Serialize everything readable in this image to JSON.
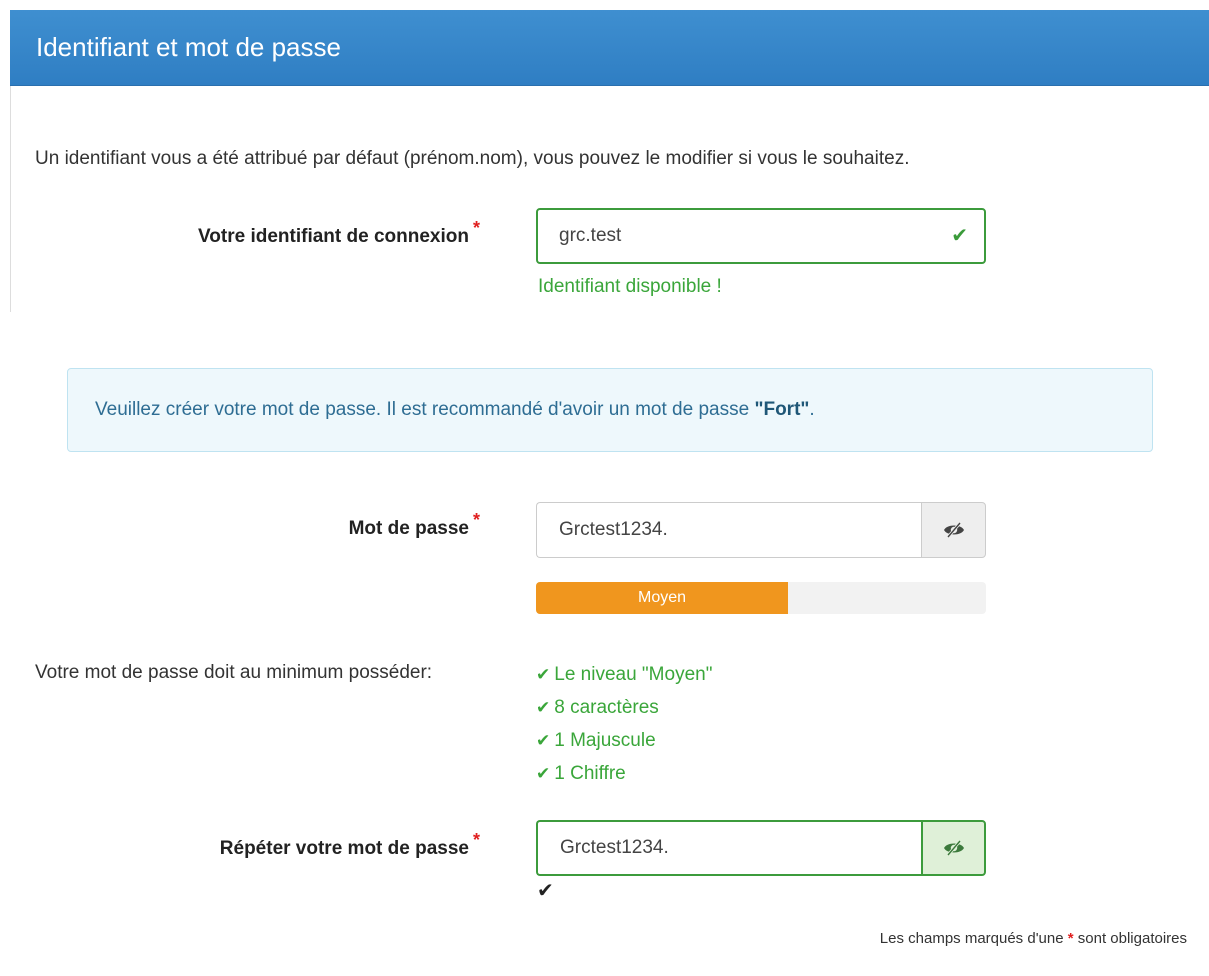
{
  "header": {
    "title": "Identifiant et mot de passe"
  },
  "intro_text": "Un identifiant vous a été attribué par défaut (prénom.nom), vous pouvez le modifier si vous le souhaitez.",
  "login": {
    "label": "Votre identifiant de connexion",
    "required_marker": "*",
    "value": "grc.test",
    "status_icon": "check-icon",
    "help_text": "Identifiant disponible !"
  },
  "alert": {
    "text_before": "Veuillez créer votre mot de passe. Il est recommandé d'avoir un mot de passe ",
    "text_strong": "\"Fort\"",
    "text_after": "."
  },
  "password": {
    "label": "Mot de passe",
    "required_marker": "*",
    "value": "Grctest1234.",
    "toggle_icon": "eye-slash-icon",
    "strength_label": "Moyen",
    "strength_fraction": 0.56,
    "strength_color": "#f0961e"
  },
  "requirements": {
    "label": "Votre mot de passe doit au minimum posséder:",
    "items": [
      "Le niveau \"Moyen\"",
      "8 caractères",
      "1 Majuscule",
      "1 Chiffre"
    ],
    "item_icon": "check-icon",
    "color": "#3aa63a"
  },
  "confirm_password": {
    "label": "Répéter votre mot de passe",
    "required_marker": "*",
    "value": "Grctest1234.",
    "toggle_icon": "eye-slash-icon",
    "match_icon": "check-icon"
  },
  "footer": {
    "text_before": "Les champs marqués d'une ",
    "star": "*",
    "text_after": " sont obligatoires"
  },
  "colors": {
    "header_bg": "#3484c8",
    "success": "#3c9b3c",
    "required": "#e02020",
    "alert_bg": "#eef8fc"
  }
}
